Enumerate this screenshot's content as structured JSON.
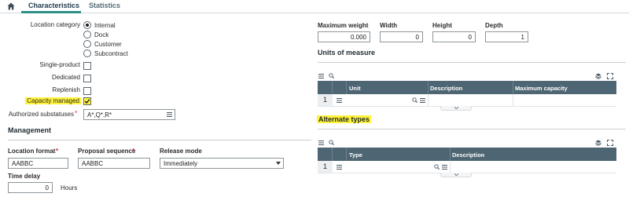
{
  "tabs": [
    {
      "label": "Characteristics",
      "active": true
    },
    {
      "label": "Statistics",
      "active": false
    }
  ],
  "location_category": {
    "label": "Location category",
    "options": [
      "Internal",
      "Dock",
      "Customer",
      "Subcontract"
    ],
    "selected": "Internal"
  },
  "checkboxes": {
    "single_product": {
      "label": "Single-product",
      "checked": false
    },
    "dedicated": {
      "label": "Dedicated",
      "checked": false
    },
    "replenish": {
      "label": "Replenish",
      "checked": false
    },
    "capacity_managed": {
      "label": "Capacity managed",
      "checked": true
    }
  },
  "authorized_substatuses": {
    "label": "Authorized substatuses",
    "required_mark": "*",
    "value": "A*,Q*,R*"
  },
  "management": {
    "title": "Management",
    "location_format": {
      "label": "Location format",
      "required_mark": "*",
      "value": "AABBC"
    },
    "proposal_sequence": {
      "label": "Proposal sequence",
      "required_mark": "*",
      "value": "AABBC"
    },
    "release_mode": {
      "label": "Release mode",
      "value": "Immediately"
    },
    "time_delay": {
      "label": "Time delay",
      "value": "0",
      "unit": "Hours"
    }
  },
  "dimensions": {
    "max_weight": {
      "label": "Maximum weight",
      "value": "0.000"
    },
    "width": {
      "label": "Width",
      "value": "0"
    },
    "height": {
      "label": "Height",
      "value": "0"
    },
    "depth": {
      "label": "Depth",
      "value": "1"
    }
  },
  "units_of_measure": {
    "title": "Units of measure",
    "columns": [
      "Unit",
      "Description",
      "Maximum capacity"
    ],
    "row_number": "1"
  },
  "alternate_types": {
    "title": "Alternate types",
    "columns": [
      "Type",
      "Description"
    ],
    "row_number": "1"
  },
  "icons": {
    "home": "home-icon",
    "menu": "hamburger-menu-icon",
    "search": "search-icon",
    "layers": "layers-icon",
    "expand": "expand-icon",
    "chevron": "chevron-down-icon"
  },
  "colors": {
    "accent": "#2e8f88",
    "grid_header": "#4e6573",
    "highlight": "#fff23a",
    "required": "#d6232f"
  }
}
